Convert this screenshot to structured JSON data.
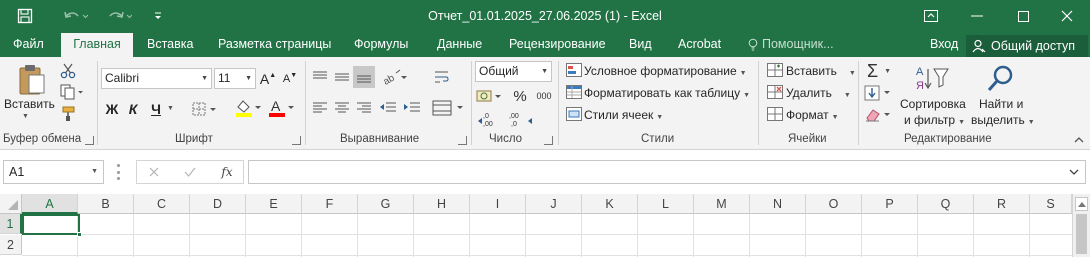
{
  "window": {
    "title": "Отчет_01.01.2025_27.06.2025 (1) - Excel",
    "sign_in": "Вход",
    "share": "Общий доступ"
  },
  "tabs": [
    {
      "label": "Файл"
    },
    {
      "label": "Главная",
      "active": true
    },
    {
      "label": "Вставка"
    },
    {
      "label": "Разметка страницы"
    },
    {
      "label": "Формулы"
    },
    {
      "label": "Данные"
    },
    {
      "label": "Рецензирование"
    },
    {
      "label": "Вид"
    },
    {
      "label": "Acrobat"
    },
    {
      "label": "Помощник..."
    }
  ],
  "ribbon": {
    "clipboard": {
      "paste": "Вставить",
      "label": "Буфер обмена"
    },
    "font": {
      "name": "Calibri",
      "size": "11",
      "bold": "Ж",
      "italic": "К",
      "underline": "Ч",
      "grow": "A",
      "shrink": "A",
      "color_letter": "A",
      "highlight_color": "#ffff00",
      "font_color": "#ff0000",
      "label": "Шрифт"
    },
    "alignment": {
      "label": "Выравнивание"
    },
    "number": {
      "format": "Общий",
      "percent": "%",
      "thousands": "000",
      "inc_decimal": ",0 ,00",
      "dec_decimal": ",00 ,0",
      "label": "Число"
    },
    "styles": {
      "conditional": "Условное форматирование",
      "as_table": "Форматировать как таблицу",
      "cell_styles": "Стили ячеек",
      "label": "Стили"
    },
    "cells": {
      "insert": "Вставить",
      "delete": "Удалить",
      "format": "Формат",
      "label": "Ячейки"
    },
    "editing": {
      "sum": "Σ",
      "sort_line1": "Сортировка",
      "sort_line2": "и фильтр",
      "find_line1": "Найти и",
      "find_line2": "выделить",
      "label": "Редактирование"
    }
  },
  "formula_bar": {
    "name_box": "A1",
    "fx": "fx",
    "value": ""
  },
  "grid": {
    "columns": [
      "A",
      "B",
      "C",
      "D",
      "E",
      "F",
      "G",
      "H",
      "I",
      "J",
      "K",
      "L",
      "M",
      "N",
      "O",
      "P",
      "Q",
      "R",
      "S"
    ],
    "rows": [
      "1",
      "2"
    ],
    "active_column": "A",
    "active_row": "1"
  },
  "colors": {
    "brand": "#217346",
    "ribbon_bg": "#f3f3f3"
  }
}
